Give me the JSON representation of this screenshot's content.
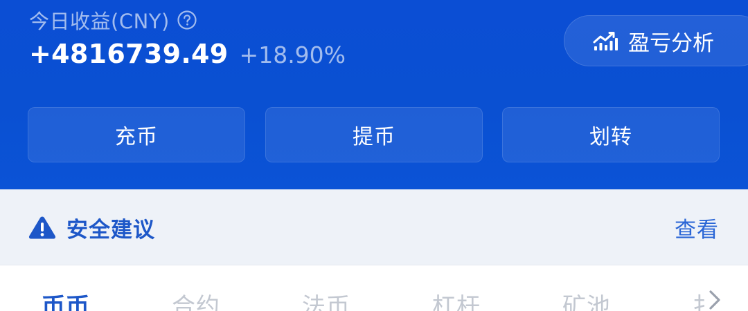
{
  "earnings": {
    "label": "今日收益(CNY)",
    "amount": "+4816739.49",
    "percent": "+18.90%"
  },
  "analysis_button": {
    "label": "盈亏分析"
  },
  "actions": {
    "deposit": "充币",
    "withdraw": "提币",
    "transfer": "划转"
  },
  "security": {
    "title": "安全建议",
    "view": "查看"
  },
  "tabs": [
    {
      "label": "币币",
      "active": true
    },
    {
      "label": "合约",
      "active": false
    },
    {
      "label": "法币",
      "active": false
    },
    {
      "label": "杠杆",
      "active": false
    },
    {
      "label": "矿池",
      "active": false
    },
    {
      "label": "扌",
      "active": false
    }
  ],
  "icons": {
    "help": "question-circle-icon",
    "analysis": "chart-line-icon",
    "warning": "warning-triangle-icon",
    "more": "chevron-right-icon"
  },
  "colors": {
    "header_bg": "#0b4ed4",
    "accent": "#1d57c8",
    "banner_bg": "#eef2f8"
  }
}
